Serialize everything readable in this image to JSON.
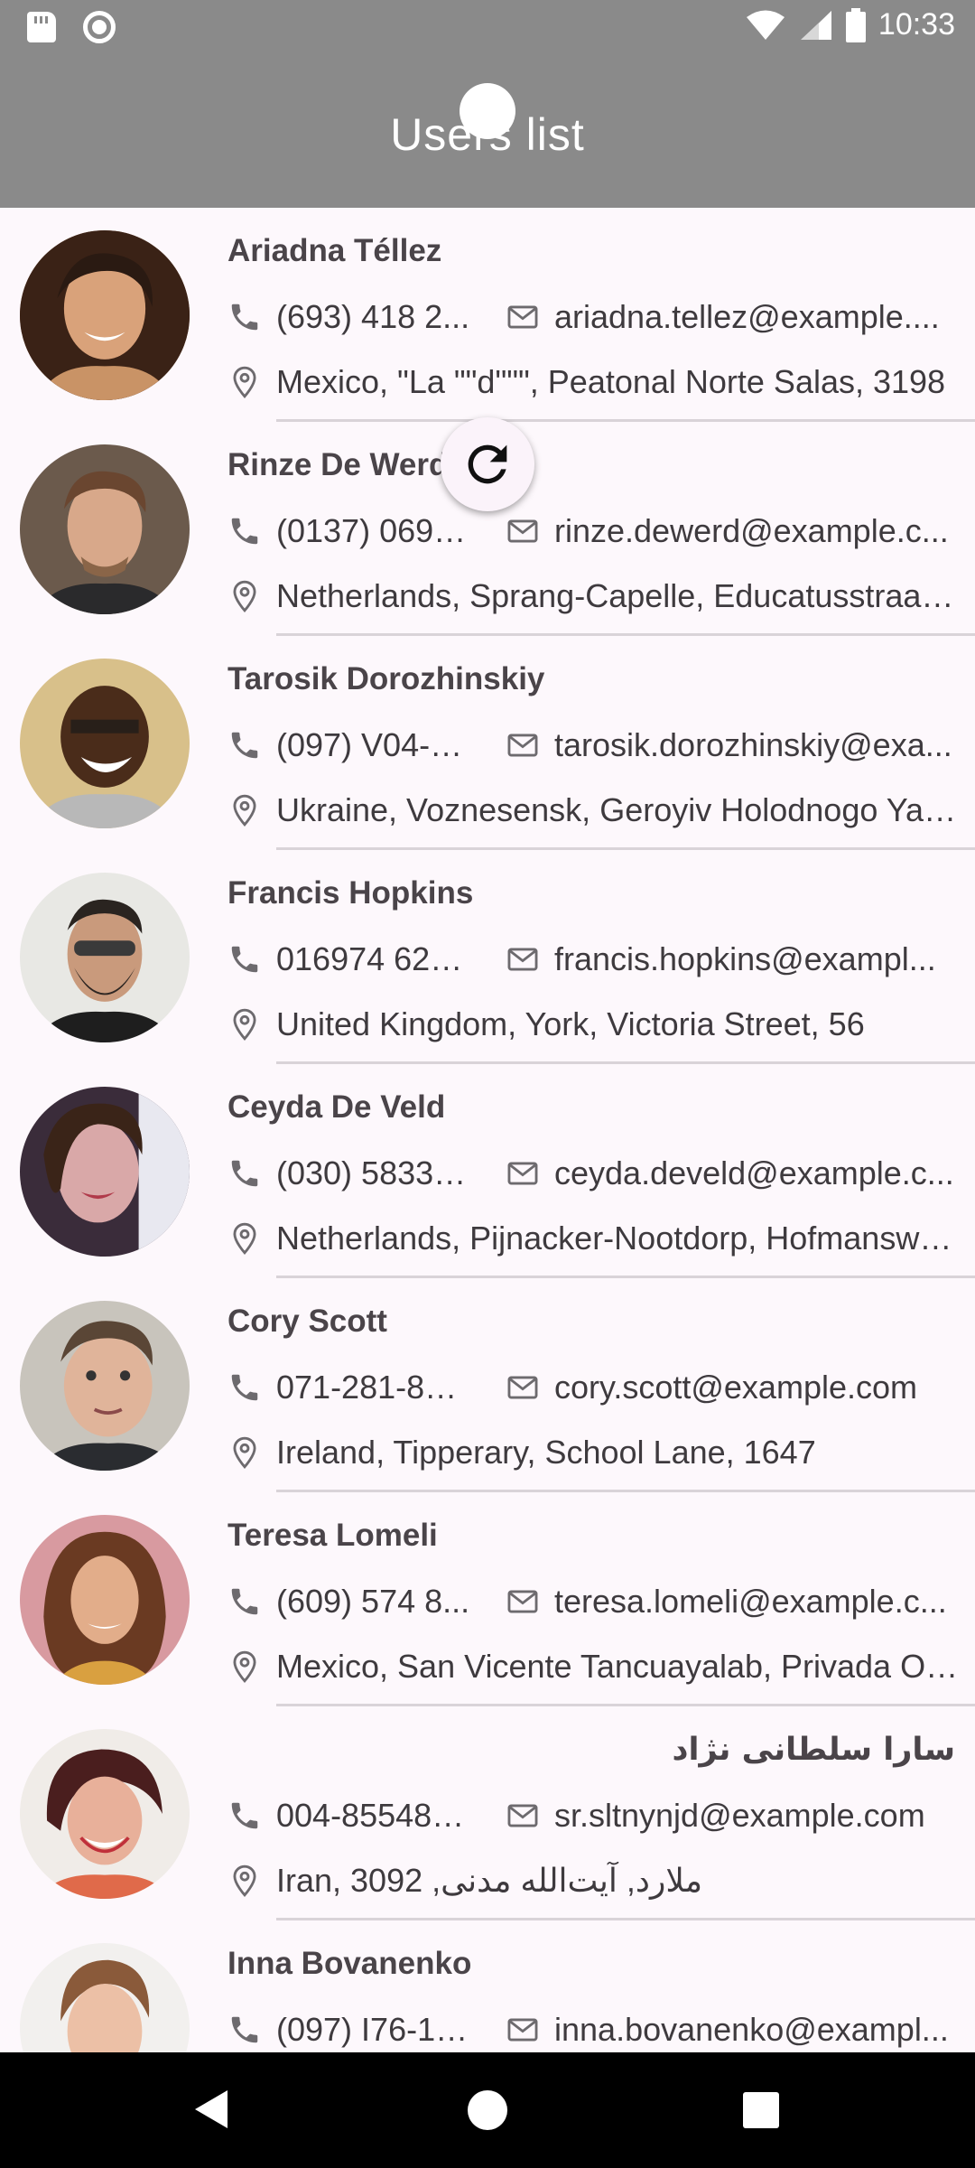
{
  "status_bar": {
    "time": "10:33",
    "icons": [
      "sd-card-icon",
      "record-icon",
      "wifi-icon",
      "signal-icon",
      "battery-icon"
    ]
  },
  "app_bar": {
    "title": "Users list"
  },
  "users": [
    {
      "name": "Ariadna Téllez",
      "phone": "(693) 418 2...",
      "email": "ariadna.tellez@example....",
      "address": "Mexico, \"La \"\"d\"\"\", Peatonal Norte Salas, 3198"
    },
    {
      "name": "Rinze De Werd",
      "phone": "(0137) 0692...",
      "email": "rinze.dewerd@example.c...",
      "address": "Netherlands, Sprang-Capelle, Educatusstraat,..."
    },
    {
      "name": "Tarosik Dorozhinskiy",
      "phone": "(097) V04-3...",
      "email": "tarosik.dorozhinskiy@exa...",
      "address": "Ukraine, Voznesensk, Geroyiv Holodnogo Yar..."
    },
    {
      "name": "Francis Hopkins",
      "phone": "016974 629...",
      "email": "francis.hopkins@exampl...",
      "address": "United Kingdom, York, Victoria Street, 56"
    },
    {
      "name": "Ceyda De Veld",
      "phone": "(030) 58330...",
      "email": "ceyda.develd@example.c...",
      "address": "Netherlands, Pijnacker-Nootdorp, Hofmanswe..."
    },
    {
      "name": "Cory Scott",
      "phone": "071-281-8696",
      "email": "cory.scott@example.com",
      "address": "Ireland, Tipperary, School Lane, 1647"
    },
    {
      "name": "Teresa Lomeli",
      "phone": "(609) 574 8...",
      "email": "teresa.lomeli@example.c...",
      "address": "Mexico, San Vicente Tancuayalab, Privada Ol..."
    },
    {
      "name": "سارا سلطانی نژاد",
      "phone": "004-855485...",
      "email": "sr.sltnynjd@example.com",
      "address": "Iran, 3092 ,ملارد, آیت‌الله مدنی"
    },
    {
      "name": "Inna Bovanenko",
      "phone": "(097) I76-12...",
      "email": "inna.bovanenko@exampl...",
      "address": ""
    }
  ],
  "colors": {
    "app_bar": "#8a8a8a",
    "background": "#fdf8fc",
    "text": "#3e3a3e",
    "icon": "#6d6a6e"
  }
}
